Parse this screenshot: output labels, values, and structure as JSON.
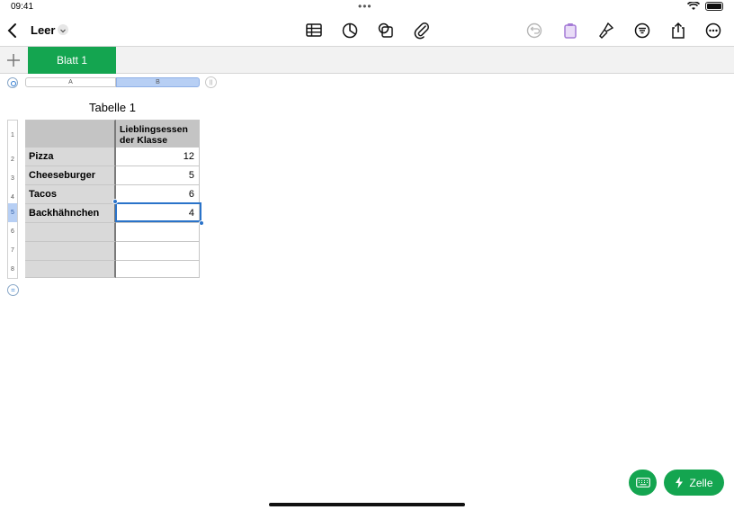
{
  "status_bar": {
    "time": "09:41",
    "dots": "•••"
  },
  "toolbar": {
    "document_title": "Leer",
    "icons": [
      "back-chevron-icon",
      "table-icon",
      "chart-icon",
      "shape-icon",
      "attachment-icon",
      "undo-icon",
      "clipboard-icon",
      "format-brush-icon",
      "organize-icon",
      "share-icon",
      "more-icon"
    ]
  },
  "sheets": {
    "add_icon": "plus-icon",
    "tabs": [
      {
        "label": "Blatt 1",
        "active": true
      }
    ]
  },
  "table": {
    "title": "Tabelle 1",
    "column_headers": [
      "A",
      "B"
    ],
    "row_numbers": [
      "1",
      "2",
      "3",
      "4",
      "5",
      "6",
      "7",
      "8"
    ],
    "header_row": {
      "a": "",
      "b_line1": "Lieblingsessen",
      "b_line2": "der Klasse"
    },
    "rows": [
      {
        "label": "Pizza",
        "value": "12"
      },
      {
        "label": "Cheeseburger",
        "value": "5"
      },
      {
        "label": "Tacos",
        "value": "6"
      },
      {
        "label": "Backhähnchen",
        "value": "4"
      },
      {
        "label": "",
        "value": ""
      },
      {
        "label": "",
        "value": ""
      },
      {
        "label": "",
        "value": ""
      }
    ],
    "selected_row": "5"
  },
  "bottom_buttons": {
    "keyboard_icon": "keyboard-icon",
    "cell_label": "Zelle",
    "cell_icon": "lightning-icon"
  },
  "colors": {
    "accent_green": "#14a550",
    "selection_blue": "#2a73c9"
  }
}
